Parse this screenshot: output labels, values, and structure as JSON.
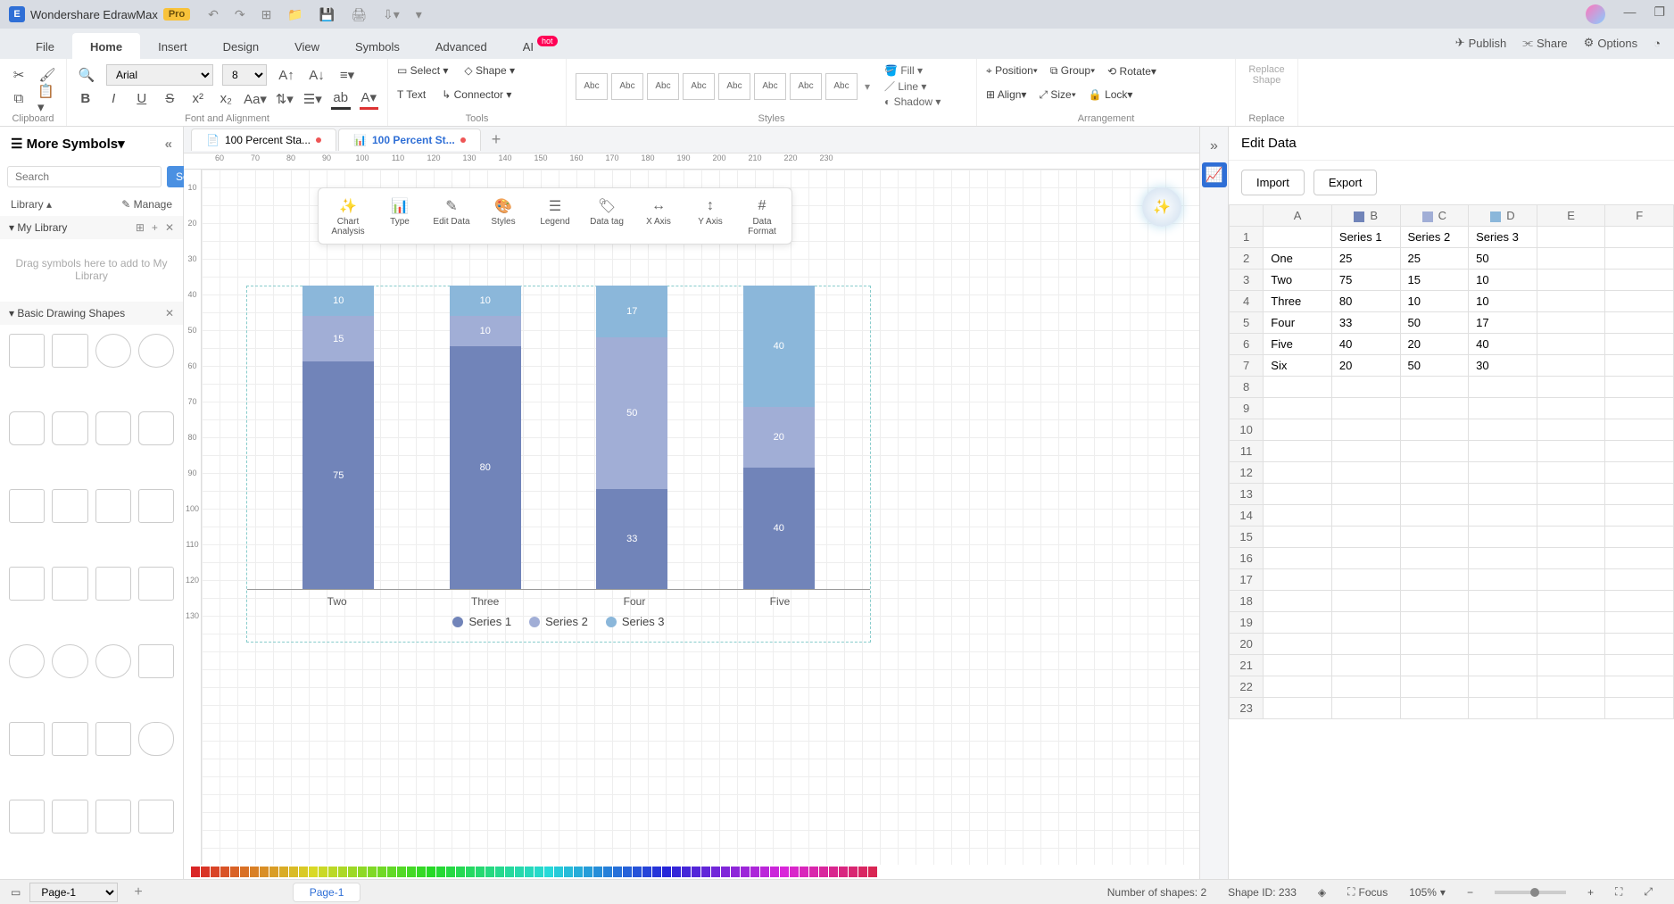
{
  "app": {
    "title": "Wondershare EdrawMax",
    "badge": "Pro"
  },
  "menu": {
    "items": [
      "File",
      "Home",
      "Insert",
      "Design",
      "View",
      "Symbols",
      "Advanced",
      "AI"
    ],
    "active": "Home",
    "hot": "hot",
    "right": {
      "publish": "Publish",
      "share": "Share",
      "options": "Options"
    }
  },
  "ribbon": {
    "font": "Arial",
    "size": "8",
    "select": "Select",
    "shape": "Shape",
    "text": "Text",
    "connector": "Connector",
    "style_label": "Abc",
    "fill": "Fill",
    "line": "Line",
    "shadow": "Shadow",
    "position": "Position",
    "group": "Group",
    "rotate": "Rotate",
    "align": "Align",
    "sizebtn": "Size",
    "lock": "Lock",
    "replace_shape": "Replace\nShape",
    "g_clipboard": "Clipboard",
    "g_font": "Font and Alignment",
    "g_tools": "Tools",
    "g_styles": "Styles",
    "g_arrange": "Arrangement",
    "g_replace": "Replace"
  },
  "left": {
    "more_symbols": "More Symbols",
    "search_ph": "Search",
    "search_btn": "Search",
    "library": "Library",
    "manage": "Manage",
    "mylib": "My Library",
    "droptext": "Drag symbols here to add to My Library",
    "basic": "Basic Drawing Shapes"
  },
  "tabs": [
    {
      "label": "100 Percent Sta...",
      "active": false
    },
    {
      "label": "100 Percent St...",
      "active": true
    }
  ],
  "chart_toolbar": [
    "Chart Analysis",
    "Type",
    "Edit Data",
    "Styles",
    "Legend",
    "Data tag",
    "X Axis",
    "Y Axis",
    "Data Format"
  ],
  "chart_data": {
    "type": "bar",
    "stacked": true,
    "percent": true,
    "categories_full": [
      "One",
      "Two",
      "Three",
      "Four",
      "Five",
      "Six"
    ],
    "categories_visible": [
      "Two",
      "Three",
      "Four",
      "Five"
    ],
    "series": [
      {
        "name": "Series 1",
        "color": "#7184b9",
        "values": [
          25,
          75,
          80,
          33,
          40,
          20
        ]
      },
      {
        "name": "Series 2",
        "color": "#a1aed6",
        "values": [
          25,
          15,
          10,
          50,
          20,
          50
        ]
      },
      {
        "name": "Series 3",
        "color": "#8bb7da",
        "values": [
          50,
          10,
          10,
          17,
          40,
          30
        ]
      }
    ],
    "visible_columns": {
      "Two": {
        "Series 1": 75,
        "Series 2": 15,
        "Series 3": 10
      },
      "Three": {
        "Series 1": 80,
        "Series 2": 10,
        "Series 3": 10
      },
      "Four": {
        "Series 1": 33,
        "Series 2": 50,
        "Series 3": 17
      },
      "Five": {
        "Series 1": 40,
        "Series 2": 20,
        "Series 3": 40
      }
    },
    "legend": [
      "Series 1",
      "Series 2",
      "Series 3"
    ]
  },
  "edit_data": {
    "title": "Edit Data",
    "import": "Import",
    "export": "Export",
    "cols": [
      "A",
      "B",
      "C",
      "D",
      "E",
      "F"
    ],
    "series_headers": [
      "",
      "Series 1",
      "Series 2",
      "Series 3"
    ],
    "rows": [
      [
        "One",
        "25",
        "25",
        "50"
      ],
      [
        "Two",
        "75",
        "15",
        "10"
      ],
      [
        "Three",
        "80",
        "10",
        "10"
      ],
      [
        "Four",
        "33",
        "50",
        "17"
      ],
      [
        "Five",
        "40",
        "20",
        "40"
      ],
      [
        "Six",
        "20",
        "50",
        "30"
      ]
    ],
    "empty_rows": 16
  },
  "status": {
    "page_sel": "Page-1",
    "page_tab": "Page-1",
    "shapes": "Number of shapes: 2",
    "shapeid": "Shape ID: 233",
    "focus": "Focus",
    "zoom": "105%"
  },
  "ruler_h": [
    "60",
    "70",
    "80",
    "90",
    "100",
    "110",
    "120",
    "130",
    "140",
    "150",
    "160",
    "170",
    "180",
    "190",
    "200",
    "210",
    "220",
    "230"
  ],
  "ruler_v": [
    "10",
    "20",
    "30",
    "40",
    "50",
    "60",
    "70",
    "80",
    "90",
    "100",
    "110",
    "120",
    "130"
  ]
}
